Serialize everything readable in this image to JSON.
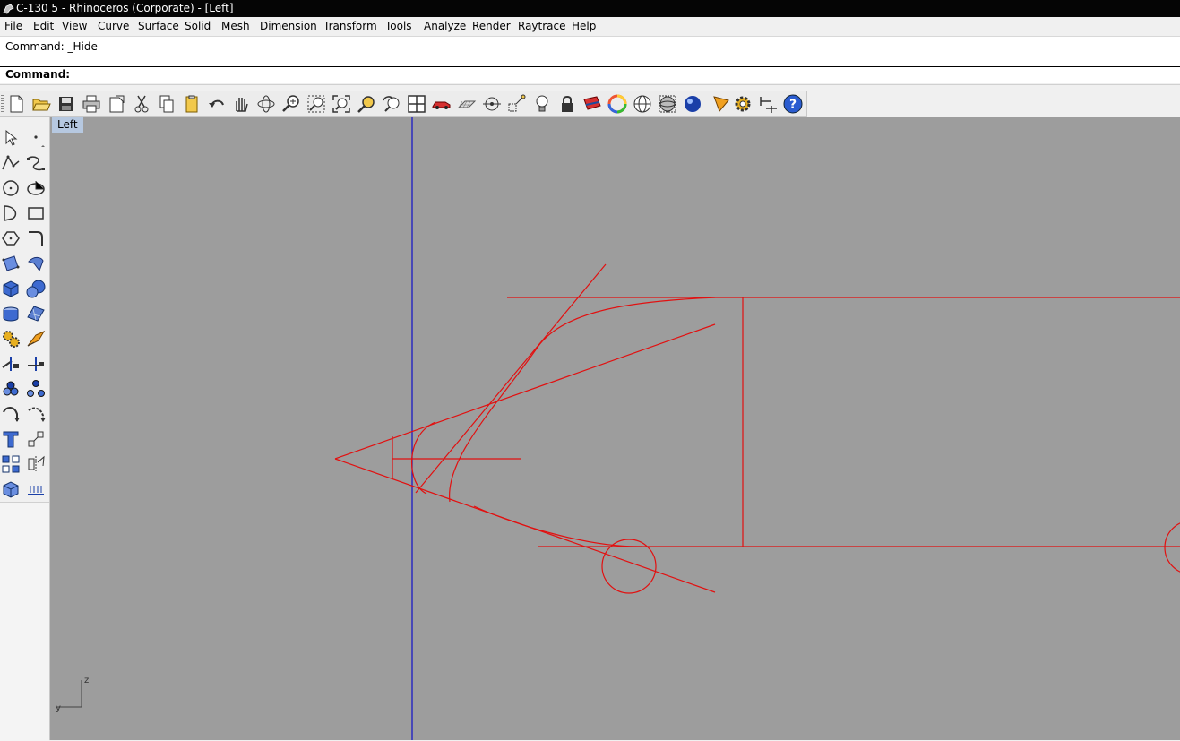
{
  "window": {
    "title": "C-130 5 - Rhinoceros (Corporate) - [Left]",
    "icon": "rhino-app-icon"
  },
  "menu": {
    "items": [
      {
        "key": "file",
        "label": "File"
      },
      {
        "key": "edit",
        "label": "Edit"
      },
      {
        "key": "view",
        "label": "View"
      },
      {
        "key": "curve",
        "label": "Curve"
      },
      {
        "key": "surface",
        "label": "Surface"
      },
      {
        "key": "solid",
        "label": "Solid"
      },
      {
        "key": "mesh",
        "label": "Mesh"
      },
      {
        "key": "dimension",
        "label": "Dimension"
      },
      {
        "key": "transform",
        "label": "Transform"
      },
      {
        "key": "tools",
        "label": "Tools"
      },
      {
        "key": "analyze",
        "label": "Analyze"
      },
      {
        "key": "render",
        "label": "Render"
      },
      {
        "key": "raytrace",
        "label": "Raytrace"
      },
      {
        "key": "help",
        "label": "Help"
      }
    ]
  },
  "command": {
    "history": "Command: _Hide",
    "prompt_label": "Command:",
    "input_value": ""
  },
  "toolbar": {
    "icons": [
      "new-file-icon",
      "open-folder-icon",
      "save-icon",
      "print-icon",
      "export-icon",
      "cut-icon",
      "copy-icon",
      "paste-icon",
      "undo-icon",
      "pan-hand-icon",
      "rotate-view-icon",
      "zoom-dynamic-icon",
      "zoom-window-icon",
      "zoom-extents-icon",
      "zoom-selected-icon",
      "undo-view-icon",
      "four-viewports-icon",
      "car-icon",
      "grid-plane-icon",
      "cplane-icon",
      "snap-icon",
      "light-icon",
      "lock-icon",
      "layer-icon",
      "color-wheel-icon",
      "wireframe-sphere-icon",
      "shaded-sphere-icon",
      "rendered-sphere-icon",
      "render-settings-icon",
      "options-gear-icon",
      "dimension-tool-icon",
      "help-icon"
    ]
  },
  "sidebar": {
    "tools": [
      "select-arrow-icon",
      "point-icon",
      "polyline-icon",
      "curve-icon",
      "circle-icon",
      "ellipse-icon",
      "arc-icon",
      "rectangle-icon",
      "polygon-icon",
      "fillet-curve-icon",
      "surface-from-points-icon",
      "loft-surface-icon",
      "box-solid-icon",
      "sphere-solid-icon",
      "cylinder-solid-icon",
      "planar-surface-icon",
      "boolean-gear-icon",
      "explode-icon",
      "trim-icon",
      "split-icon",
      "group-icon",
      "ungroup-icon",
      "rotate-icon",
      "move-icon",
      "text-icon",
      "scale-icon",
      "array-icon",
      "mirror-icon",
      "cplane-box-icon",
      "dimension-icon"
    ]
  },
  "viewport": {
    "title": "Left",
    "axis_labels": {
      "z": "z",
      "y": "y"
    },
    "colors": {
      "background": "#9d9d9d",
      "geometry": "#e21010",
      "axis": "#1010c8",
      "title_bg": "#b6c8e0"
    }
  }
}
